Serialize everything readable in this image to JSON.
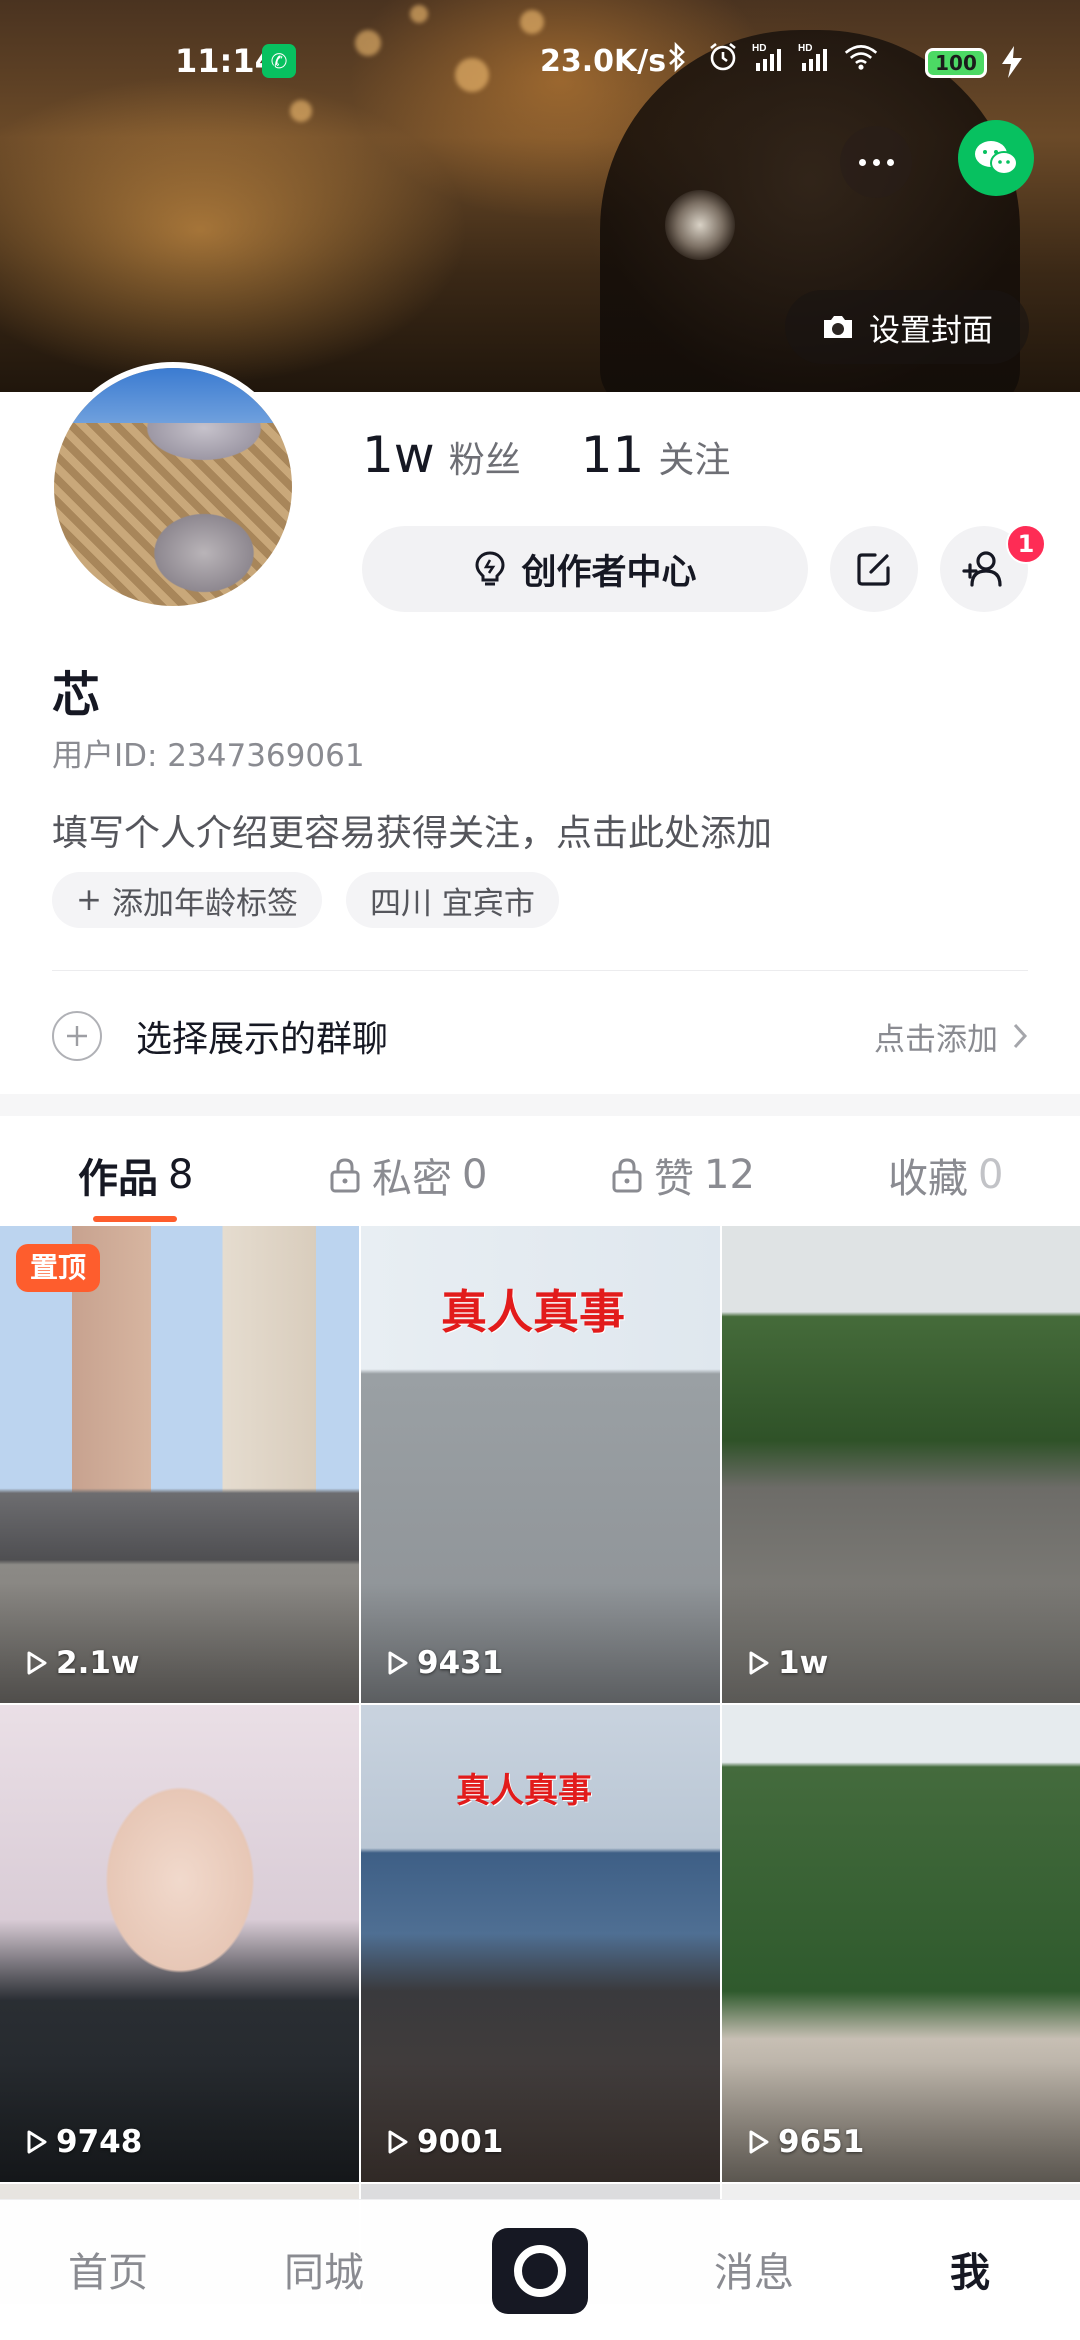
{
  "status_bar": {
    "time": "11:14",
    "app_icon": "wechat-icon",
    "network_speed": "23.0K/s",
    "icons": [
      "bluetooth-icon",
      "alarm-icon",
      "signal-hd-icon",
      "signal-hd-icon",
      "wifi-icon"
    ],
    "battery": "100",
    "charging_icon": "bolt-icon"
  },
  "cover": {
    "set_cover_label": "设置封面",
    "more_icon": "more-horizontal-icon",
    "wechat_icon": "wechat-icon",
    "camera_icon": "camera-icon"
  },
  "profile": {
    "nickname": "芯",
    "user_id": "用户ID: 2347369061",
    "bio_placeholder": "填写个人介绍更容易获得关注，点击此处添加",
    "followers_count": "1w",
    "followers_label": "粉丝",
    "following_count": "11",
    "following_label": "关注",
    "creator_center_label": "创作者中心",
    "add_friend_badge": "1",
    "tags": {
      "age_tag": "添加年龄标签",
      "location_tag": "四川 宜宾市"
    }
  },
  "group_chat": {
    "label": "选择展示的群聊",
    "action": "点击添加"
  },
  "tabs": [
    {
      "label": "作品",
      "count": "8",
      "locked": false,
      "active": true
    },
    {
      "label": "私密",
      "count": "0",
      "locked": true,
      "active": false
    },
    {
      "label": "赞",
      "count": "12",
      "locked": true,
      "active": false
    },
    {
      "label": "收藏",
      "count": "0",
      "locked": false,
      "active": false
    }
  ],
  "videos": [
    {
      "plays": "2.1w",
      "pinned_label": "置顶"
    },
    {
      "plays": "9431",
      "caption": "真人真事"
    },
    {
      "plays": "1w"
    },
    {
      "plays": "9748"
    },
    {
      "plays": "9001",
      "caption": "真人真事"
    },
    {
      "plays": "9651"
    }
  ],
  "bottom_nav": {
    "home": "首页",
    "nearby": "同城",
    "messages": "消息",
    "me": "我"
  },
  "colors": {
    "accent": "#fe5d2d",
    "badge": "#fe2c55",
    "wechat_green": "#07c160",
    "text_primary": "#161823",
    "text_secondary": "#8a8b91"
  }
}
